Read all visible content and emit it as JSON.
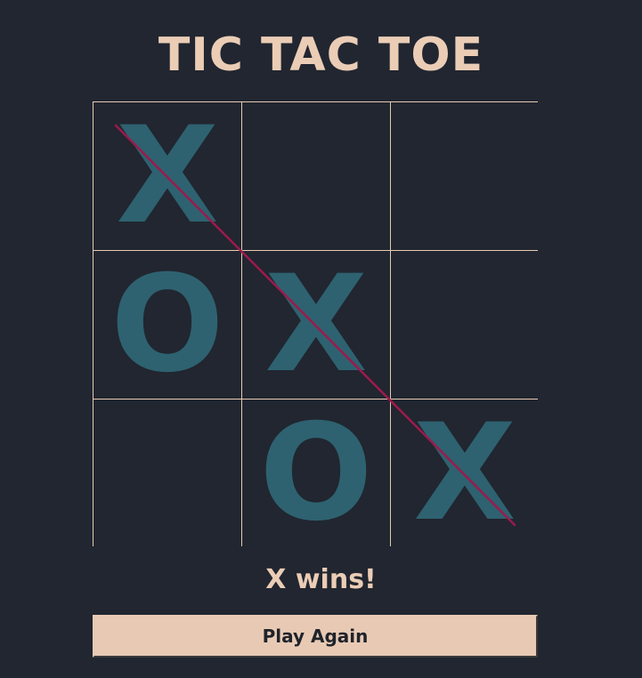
{
  "game": {
    "title": "TIC TAC TOE",
    "board": [
      [
        "X",
        "",
        ""
      ],
      [
        "O",
        "X",
        ""
      ],
      [
        "",
        "O",
        "X"
      ]
    ],
    "winning_line": "diagonal top-left to bottom-right",
    "status": "X wins!",
    "play_again_label": "Play Again"
  },
  "colors": {
    "background": "#212630",
    "title_text": "#ebcdb6",
    "grid_lines": "#e8c9b4",
    "mark": "#2e6270",
    "win_line": "#9c1a4c",
    "button_bg": "#e8cab4",
    "button_text": "#1f232b"
  }
}
